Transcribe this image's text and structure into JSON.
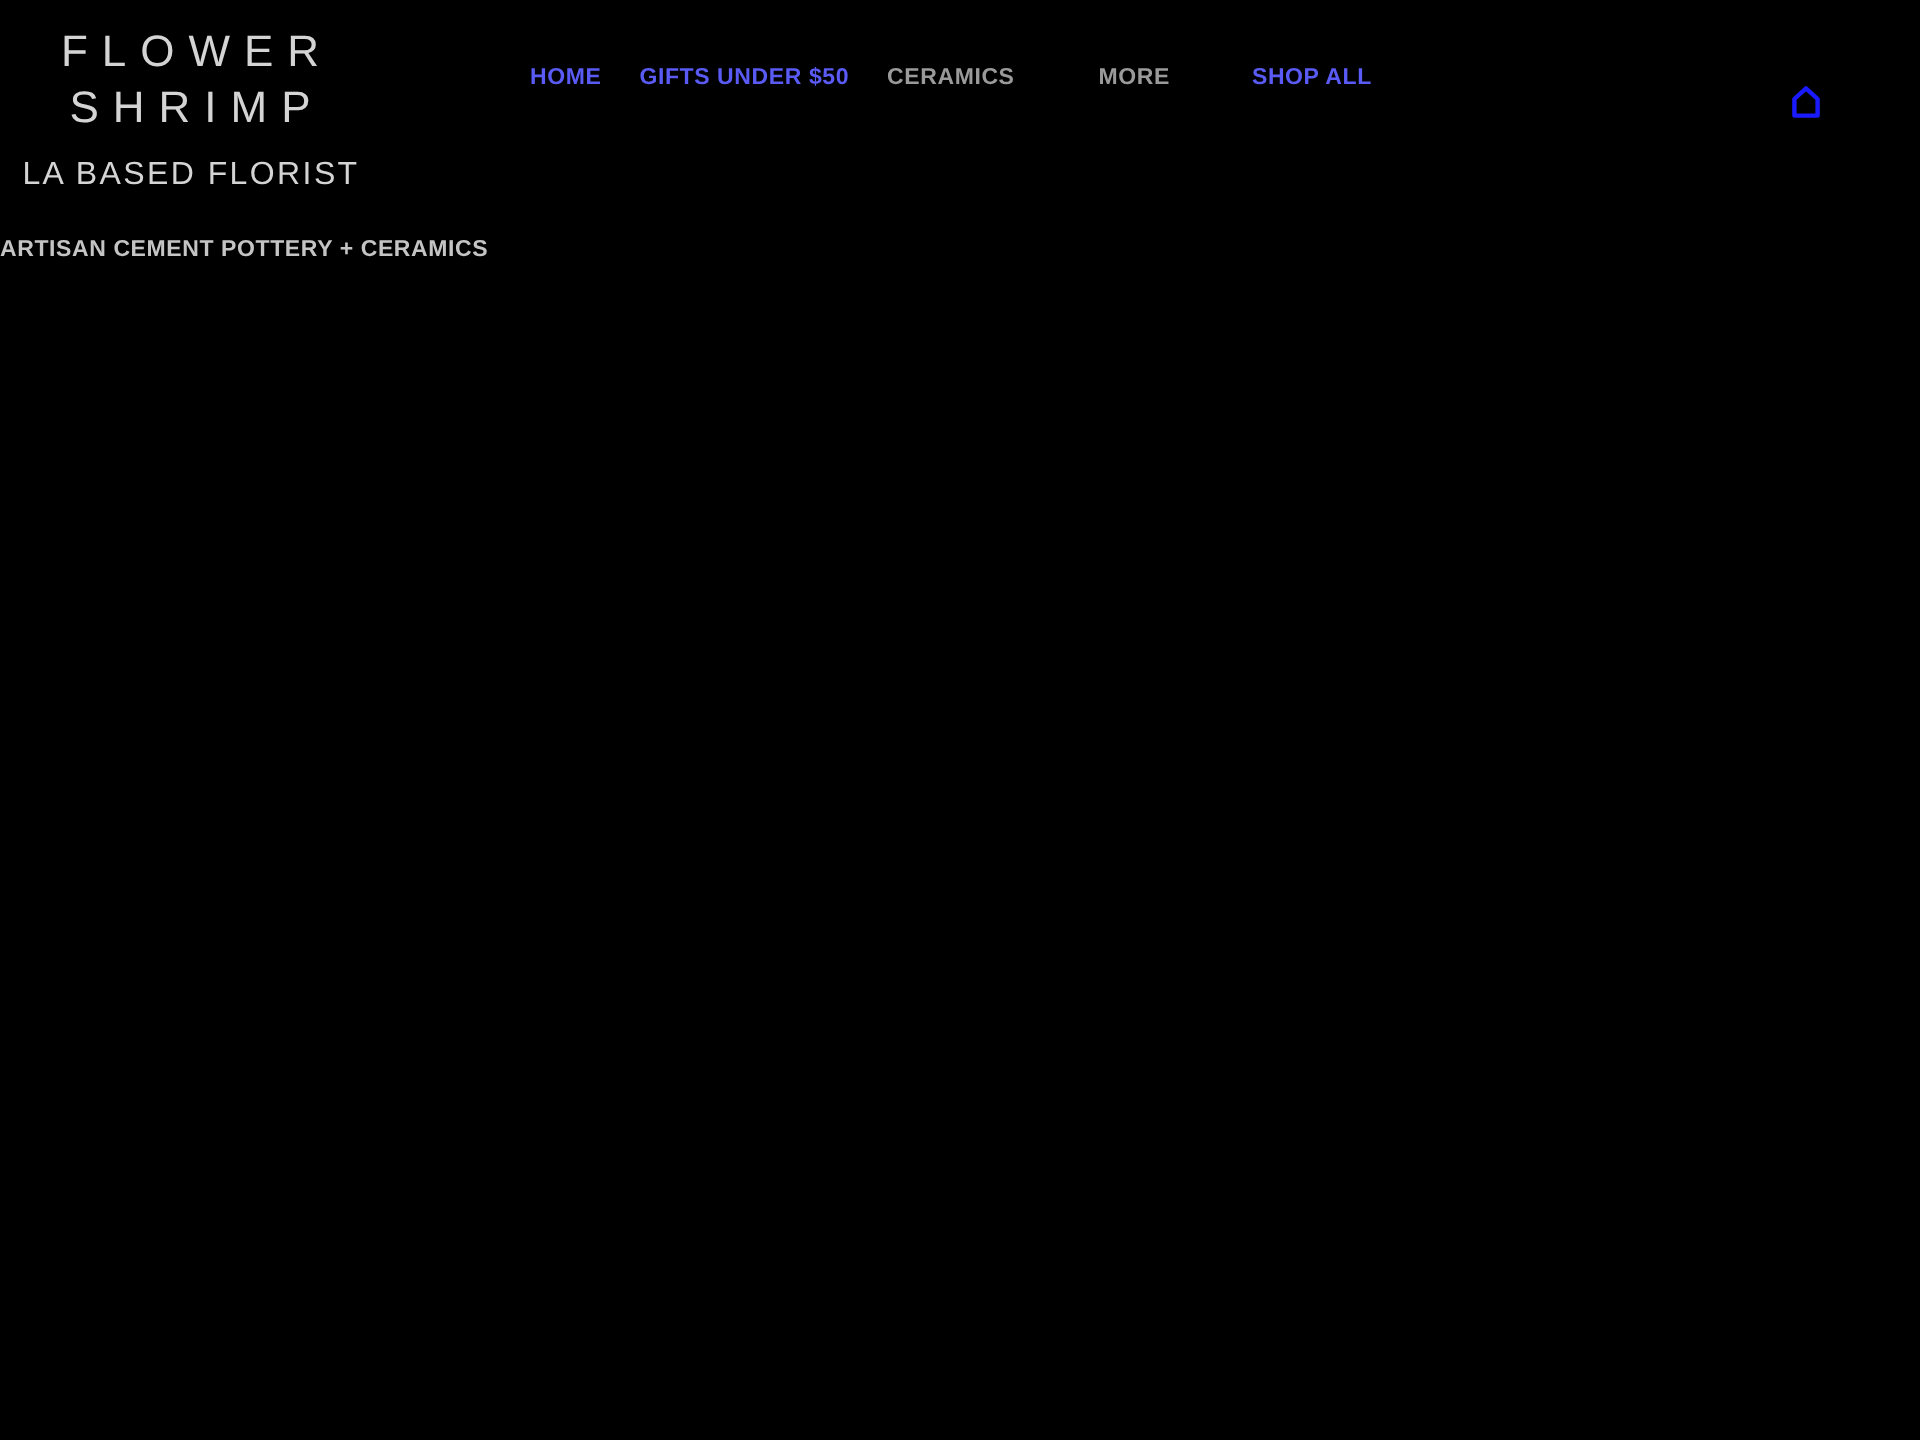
{
  "logo": {
    "lines": [
      "FLOWER",
      "SHRIMP"
    ],
    "subtitle": "LA BASED FLORIST"
  },
  "nav": [
    {
      "label": "HOME",
      "color": "#5a5af5"
    },
    {
      "label": "GIFTS UNDER $50",
      "color": "#5a5af5"
    },
    {
      "label": "CERAMICS",
      "color": "#9a9a9a"
    },
    {
      "label": "MORE",
      "color": "#9a9a9a"
    },
    {
      "label": "SHOP ALL",
      "color": "#5a5af5"
    }
  ],
  "tagline": "ARTISAN CEMENT POTTERY + CERAMICS"
}
